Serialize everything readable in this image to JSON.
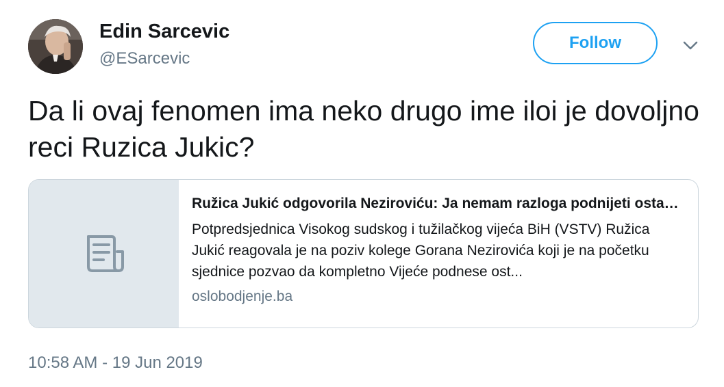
{
  "author": {
    "display_name": "Edin Sarcevic",
    "handle": "@ESarcevic"
  },
  "follow_label": "Follow",
  "tweet_text": "Da li ovaj fenomen ima neko drugo ime iloi je dovoljno reci Ruzica Jukic?",
  "card": {
    "title": "Ružica Jukić odgovorila Neziroviću: Ja nemam razloga podnijeti ostavku",
    "description": "Potpredsjednica Visokog sudskog i tužilačkog vijeća BiH (VSTV) Ružica Jukić reagovala je na poziv kolege Gorana Nezirovića koji je na početku sjednice pozvao da kompletno Vijeće podnese ost...",
    "domain": "oslobodjenje.ba",
    "thumb_icon": "document-icon"
  },
  "timestamp": "10:58 AM - 19 Jun 2019",
  "colors": {
    "accent": "#1da1f2",
    "secondary_text": "#657786",
    "border": "#ccd6dd",
    "thumb_bg": "#e1e8ed"
  }
}
